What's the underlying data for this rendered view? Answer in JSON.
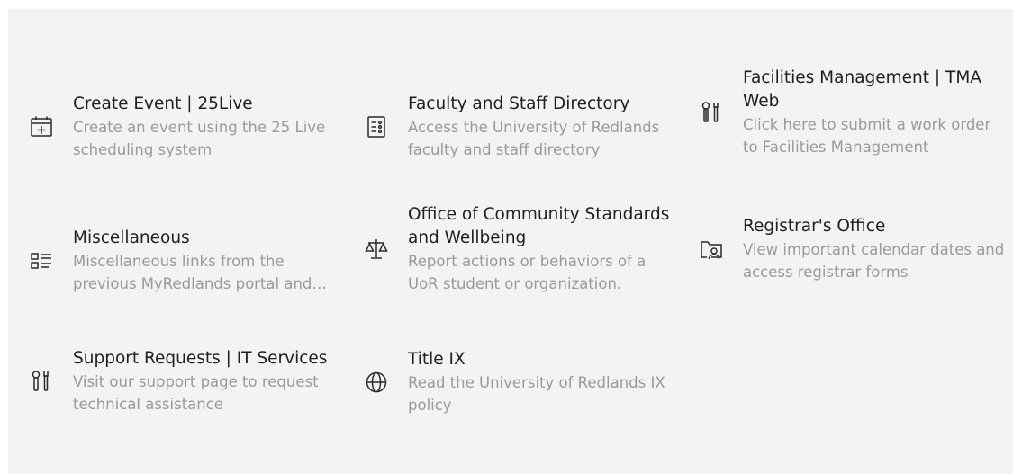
{
  "tiles": [
    {
      "title": "Create Event | 25Live",
      "description": "Create an event using the 25 Live scheduling system",
      "icon": "calendar-add-icon"
    },
    {
      "title": "Faculty and Staff Directory",
      "description": "Access the University of Redlands faculty and staff directory",
      "icon": "contact-book-icon"
    },
    {
      "title": "Facilities Management | TMA Web",
      "description": "Click here to submit a work order to Facilities Management",
      "icon": "tools-icon"
    },
    {
      "title": "Miscellaneous",
      "description": "Miscellaneous links from the previous MyRedlands portal and more",
      "icon": "list-icon"
    },
    {
      "title": "Office of Community Standards and Wellbeing",
      "description": "Report actions or behaviors of a UoR student or organization.",
      "icon": "scales-icon"
    },
    {
      "title": "Registrar's Office",
      "description": "View important calendar dates and access registrar forms",
      "icon": "folder-person-icon"
    },
    {
      "title": "Support Requests | IT Services",
      "description": "Visit our support page to request technical assistance",
      "icon": "tools-icon"
    },
    {
      "title": "Title IX",
      "description": "Read the University of Redlands IX policy",
      "icon": "globe-icon"
    }
  ]
}
